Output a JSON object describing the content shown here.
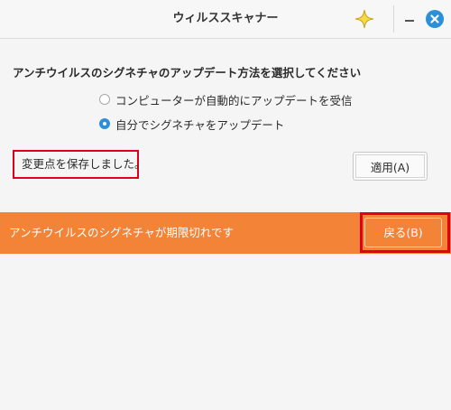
{
  "window": {
    "title": "ウィルススキャナー"
  },
  "update_settings": {
    "heading": "アンチウイルスのシグネチャのアップデート方法を選択してください",
    "options": [
      {
        "label": "コンピューターが自動的にアップデートを受信",
        "selected": false
      },
      {
        "label": "自分でシグネチャをアップデート",
        "selected": true
      }
    ],
    "status_message": "変更点を保存しました。",
    "apply_label": "適用(A)"
  },
  "banner": {
    "message": "アンチウイルスのシグネチャが期限切れです",
    "back_label": "戻る(B)",
    "color": "#f38336"
  },
  "icons": {
    "assistant": "sparkle-icon",
    "minimize": "minimize-icon",
    "close": "close-icon"
  },
  "colors": {
    "accent": "#2d8fd8",
    "highlight": "#e0001a"
  }
}
